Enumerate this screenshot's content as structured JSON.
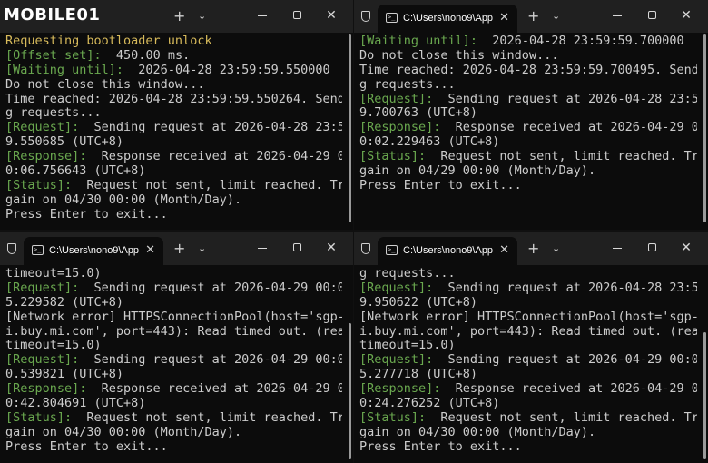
{
  "watermark": {
    "text": "MOBILE01"
  },
  "windows": [
    {
      "tab_title": "",
      "lines": [
        [
          [
            "yellow",
            "Requesting bootloader unlock"
          ]
        ],
        [
          [
            "tag",
            "[Offset set]:"
          ],
          [
            "",
            "  450.00 ms."
          ]
        ],
        [
          [
            "tag",
            "[Waiting until]:"
          ],
          [
            "",
            "  2026-04-28 23:59:59.550000"
          ]
        ],
        [
          [
            "",
            "Do not close this window..."
          ]
        ],
        [
          [
            "",
            "Time reached: 2026-04-28 23:59:59.550264. Sendin"
          ]
        ],
        [
          [
            "",
            "g requests..."
          ]
        ],
        [
          [
            "tag",
            "[Request]:"
          ],
          [
            "",
            "  Sending request at 2026-04-28 23:59:5"
          ]
        ],
        [
          [
            "",
            "9.550685 (UTC+8)"
          ]
        ],
        [
          [
            "tag",
            "[Response]:"
          ],
          [
            "",
            "  Response received at 2026-04-29 00:0"
          ]
        ],
        [
          [
            "",
            "0:06.756643 (UTC+8)"
          ]
        ],
        [
          [
            "tag",
            "[Status]:"
          ],
          [
            "",
            "  Request not sent, limit reached. Try a"
          ]
        ],
        [
          [
            "",
            "gain on 04/30 00:00 (Month/Day)."
          ]
        ],
        [
          [
            "",
            "Press Enter to exit..."
          ]
        ]
      ]
    },
    {
      "tab_title": "C:\\Users\\nono9\\App",
      "lines": [
        [
          [
            "tag",
            "[Waiting until]:"
          ],
          [
            "",
            "  2026-04-28 23:59:59.700000"
          ]
        ],
        [
          [
            "",
            "Do not close this window..."
          ]
        ],
        [
          [
            "",
            "Time reached: 2026-04-28 23:59:59.700495. Sendin"
          ]
        ],
        [
          [
            "",
            "g requests..."
          ]
        ],
        [
          [
            "tag",
            "[Request]:"
          ],
          [
            "",
            "  Sending request at 2026-04-28 23:59:5"
          ]
        ],
        [
          [
            "",
            "9.700763 (UTC+8)"
          ]
        ],
        [
          [
            "tag",
            "[Response]:"
          ],
          [
            "",
            "  Response received at 2026-04-29 00:0"
          ]
        ],
        [
          [
            "",
            "0:02.229463 (UTC+8)"
          ]
        ],
        [
          [
            "tag",
            "[Status]:"
          ],
          [
            "",
            "  Request not sent, limit reached. Try a"
          ]
        ],
        [
          [
            "",
            "gain on 04/29 00:00 (Month/Day)."
          ]
        ],
        [
          [
            "",
            "Press Enter to exit..."
          ]
        ]
      ]
    },
    {
      "tab_title": "C:\\Users\\nono9\\App",
      "lines": [
        [
          [
            "",
            "timeout=15.0)"
          ]
        ],
        [
          [
            "tag",
            "[Request]:"
          ],
          [
            "",
            "  Sending request at 2026-04-29 00:00:1"
          ]
        ],
        [
          [
            "",
            "5.229582 (UTC+8)"
          ]
        ],
        [
          [
            "",
            "[Network error] HTTPSConnectionPool(host='sgp-ap"
          ]
        ],
        [
          [
            "",
            "i.buy.mi.com', port=443): Read timed out. (read"
          ]
        ],
        [
          [
            "",
            "timeout=15.0)"
          ]
        ],
        [
          [
            "tag",
            "[Request]:"
          ],
          [
            "",
            "  Sending request at 2026-04-29 00:00:3"
          ]
        ],
        [
          [
            "",
            "0.539821 (UTC+8)"
          ]
        ],
        [
          [
            "tag",
            "[Response]:"
          ],
          [
            "",
            "  Response received at 2026-04-29 00:0"
          ]
        ],
        [
          [
            "",
            "0:42.804691 (UTC+8)"
          ]
        ],
        [
          [
            "tag",
            "[Status]:"
          ],
          [
            "",
            "  Request not sent, limit reached. Try a"
          ]
        ],
        [
          [
            "",
            "gain on 04/30 00:00 (Month/Day)."
          ]
        ],
        [
          [
            "",
            "Press Enter to exit..."
          ]
        ]
      ]
    },
    {
      "tab_title": "C:\\Users\\nono9\\App",
      "lines": [
        [
          [
            "",
            "g requests..."
          ]
        ],
        [
          [
            "tag",
            "[Request]:"
          ],
          [
            "",
            "  Sending request at 2026-04-28 23:59:5"
          ]
        ],
        [
          [
            "",
            "9.950622 (UTC+8)"
          ]
        ],
        [
          [
            "",
            "[Network error] HTTPSConnectionPool(host='sgp-ap"
          ]
        ],
        [
          [
            "",
            "i.buy.mi.com', port=443): Read timed out. (read"
          ]
        ],
        [
          [
            "",
            "timeout=15.0)"
          ]
        ],
        [
          [
            "tag",
            "[Request]:"
          ],
          [
            "",
            "  Sending request at 2026-04-29 00:00:1"
          ]
        ],
        [
          [
            "",
            "5.277718 (UTC+8)"
          ]
        ],
        [
          [
            "tag",
            "[Response]:"
          ],
          [
            "",
            "  Response received at 2026-04-29 00:0"
          ]
        ],
        [
          [
            "",
            "0:24.276252 (UTC+8)"
          ]
        ],
        [
          [
            "tag",
            "[Status]:"
          ],
          [
            "",
            "  Request not sent, limit reached. Try a"
          ]
        ],
        [
          [
            "",
            "gain on 04/30 00:00 (Month/Day)."
          ]
        ],
        [
          [
            "",
            "Press Enter to exit..."
          ]
        ]
      ]
    }
  ]
}
